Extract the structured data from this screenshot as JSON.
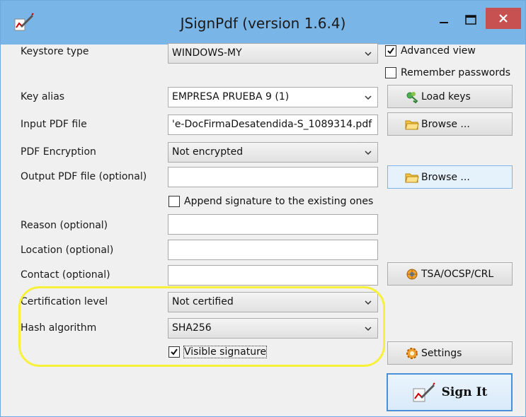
{
  "window": {
    "title": "JSignPdf (version 1.6.4)",
    "app_icon": "pen-signature-icon",
    "controls": {
      "minimize": "minimize-icon",
      "maximize": "maximize-icon",
      "close": "close-icon"
    }
  },
  "keystore": {
    "label": "Keystore type",
    "value": "WINDOWS-MY"
  },
  "advanced_view": {
    "label": "Advanced view",
    "checked": true
  },
  "remember_passwords": {
    "label": "Remember passwords",
    "checked": false
  },
  "key_alias": {
    "label": "Key alias",
    "value": "EMPRESA PRUEBA 9 (1)"
  },
  "load_keys": {
    "label": "Load keys",
    "icon": "keys-icon"
  },
  "input_pdf": {
    "label": "Input PDF file",
    "value": "'e-DocFirmaDesatendida-S_1089314.pdf"
  },
  "browse_input": {
    "label": "Browse ...",
    "icon": "folder-icon"
  },
  "pdf_encryption": {
    "label": "PDF Encryption",
    "value": "Not encrypted"
  },
  "output_pdf": {
    "label": "Output PDF file (optional)",
    "value": ""
  },
  "browse_output": {
    "label": "Browse ...",
    "icon": "folder-icon"
  },
  "append_signature": {
    "label": "Append signature to the existing ones",
    "checked": false
  },
  "reason": {
    "label": "Reason (optional)",
    "value": ""
  },
  "location": {
    "label": "Location (optional)",
    "value": ""
  },
  "contact": {
    "label": "Contact (optional)",
    "value": ""
  },
  "tsa": {
    "label": "TSA/OCSP/CRL",
    "icon": "network-icon"
  },
  "certification_level": {
    "label": "Certification level",
    "value": "Not certified"
  },
  "hash_algorithm": {
    "label": "Hash algorithm",
    "value": "SHA256"
  },
  "visible_signature": {
    "label": "Visible signature",
    "checked": true
  },
  "settings": {
    "label": "Settings",
    "icon": "gear-icon"
  },
  "sign_it": {
    "label": "Sign It",
    "icon": "pen-signature-icon"
  },
  "colors": {
    "titlebar": "#7ab5e8",
    "close": "#c75050",
    "highlight": "#f7f13a",
    "accent": "#4a90d9"
  }
}
